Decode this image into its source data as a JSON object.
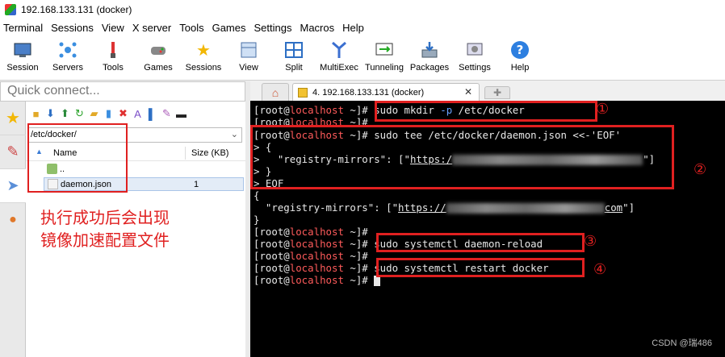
{
  "window": {
    "title": "192.168.133.131 (docker)"
  },
  "menu": [
    "Terminal",
    "Sessions",
    "View",
    "X server",
    "Tools",
    "Games",
    "Settings",
    "Macros",
    "Help"
  ],
  "toolbar": [
    {
      "label": "Session",
      "icon": "session-icon"
    },
    {
      "label": "Servers",
      "icon": "servers-icon"
    },
    {
      "label": "Tools",
      "icon": "tools-icon"
    },
    {
      "label": "Games",
      "icon": "games-icon"
    },
    {
      "label": "Sessions",
      "icon": "star-icon"
    },
    {
      "label": "View",
      "icon": "view-icon"
    },
    {
      "label": "Split",
      "icon": "split-icon"
    },
    {
      "label": "MultiExec",
      "icon": "multiexec-icon"
    },
    {
      "label": "Tunneling",
      "icon": "tunneling-icon"
    },
    {
      "label": "Packages",
      "icon": "packages-icon"
    },
    {
      "label": "Settings",
      "icon": "settings-icon"
    },
    {
      "label": "Help",
      "icon": "help-icon"
    }
  ],
  "quick_connect": {
    "placeholder": "Quick connect..."
  },
  "file_browser": {
    "path": "/etc/docker/",
    "columns": {
      "name": "Name",
      "size": "Size (KB)"
    },
    "rows": [
      {
        "name": "..",
        "size": ""
      },
      {
        "name": "daemon.json",
        "size": "1"
      }
    ]
  },
  "annotation_left": [
    "执行成功后会出现",
    "镜像加速配置文件"
  ],
  "tab": {
    "label": "4. 192.168.133.131 (docker)",
    "close": "✕"
  },
  "terminal": {
    "prompt_user": "[root@",
    "prompt_host": "localhost",
    "prompt_end": " ~]# ",
    "cmd1_a": "sudo mkdir ",
    "cmd1_opt": "-p",
    "cmd1_b": " /etc/docker",
    "cmd2": "sudo tee /etc/docker/daemon.json <<-'EOF'",
    "heredoc_open": "> {",
    "heredoc_key_pre": ">   \"registry-mirrors\": [\"",
    "heredoc_link": "https:/",
    "heredoc_tail": "\"]",
    "heredoc_close": "> }",
    "heredoc_eof": "> EOF",
    "json_open": "{",
    "json_key_pre": "  \"registry-mirrors\": [\"",
    "json_link_a": "https://",
    "json_link_b": "com",
    "json_tail": "\"]",
    "json_close": "}",
    "cmd3": "sudo systemctl daemon-reload",
    "cmd4": "sudo systemctl restart docker"
  },
  "step_numbers": [
    "①",
    "②",
    "③",
    "④"
  ],
  "watermark": "CSDN @瑞486",
  "colors": {
    "annotation_red": "#e02020",
    "prompt_host": "#ff5b5b",
    "option_blue": "#6aa2ff",
    "terminal_bg": "#000000"
  }
}
